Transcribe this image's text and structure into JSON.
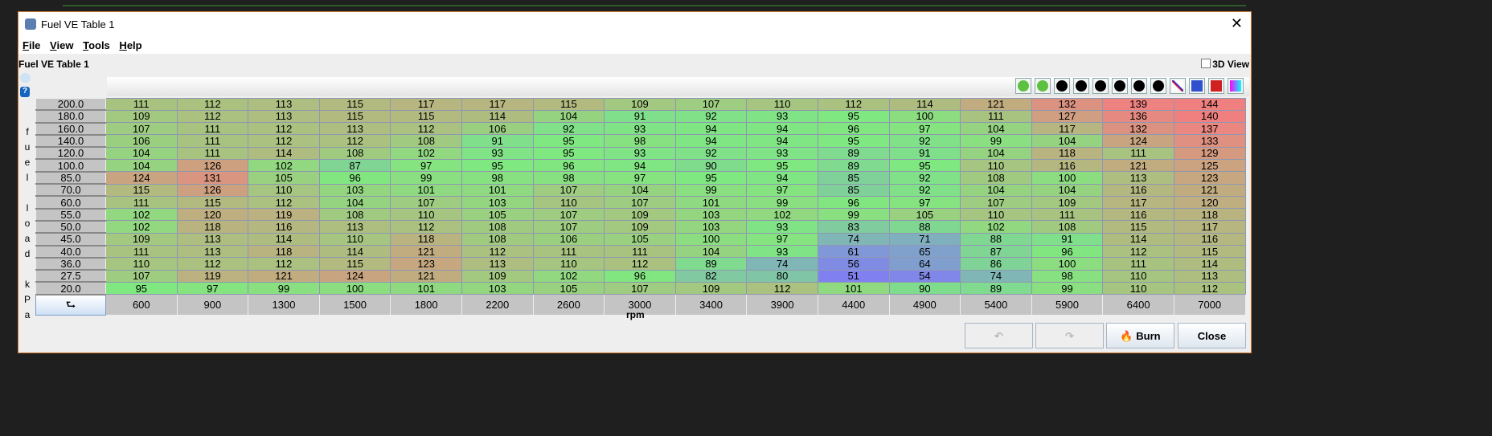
{
  "window": {
    "title": "Fuel VE Table 1",
    "close": "✕"
  },
  "menu": [
    "File",
    "View",
    "Tools",
    "Help"
  ],
  "panel_title": "Fuel VE Table 1",
  "view3d_label": "3D View",
  "y_axis_label": "fuel load kPa",
  "x_axis_label": "rpm",
  "help_icon": "?",
  "corner_icon": "⮑",
  "toolbar_icons": [
    "increment-icon",
    "decrement-icon",
    "set-equal-icon",
    "shift-up-icon",
    "shift-down-icon",
    "minus-icon",
    "plus-icon",
    "multiply-icon",
    "interpolate-icon",
    "horizontal-smooth-icon",
    "vertical-smooth-icon",
    "color-gradient-icon"
  ],
  "colors": {
    "low": "#8080f0",
    "mid": "#80e880",
    "high": "#f08080"
  },
  "load_bins": [
    "200.0",
    "180.0",
    "160.0",
    "140.0",
    "120.0",
    "100.0",
    "85.0",
    "70.0",
    "60.0",
    "55.0",
    "50.0",
    "45.0",
    "40.0",
    "36.0",
    "27.5",
    "20.0"
  ],
  "rpm_bins": [
    "600",
    "900",
    "1300",
    "1500",
    "1800",
    "2200",
    "2600",
    "3000",
    "3400",
    "3900",
    "4400",
    "4900",
    "5400",
    "5900",
    "6400",
    "7000"
  ],
  "ve": [
    [
      111,
      112,
      113,
      115,
      117,
      117,
      115,
      109,
      107,
      110,
      112,
      114,
      121,
      132,
      139,
      144
    ],
    [
      109,
      112,
      113,
      115,
      115,
      114,
      104,
      91,
      92,
      93,
      95,
      100,
      111,
      127,
      136,
      140
    ],
    [
      107,
      111,
      112,
      113,
      112,
      106,
      92,
      93,
      94,
      94,
      96,
      97,
      104,
      117,
      132,
      137
    ],
    [
      106,
      111,
      112,
      112,
      108,
      91,
      95,
      98,
      94,
      94,
      95,
      92,
      99,
      104,
      124,
      133
    ],
    [
      104,
      111,
      114,
      108,
      102,
      93,
      95,
      93,
      92,
      93,
      89,
      91,
      104,
      118,
      111,
      129
    ],
    [
      104,
      126,
      102,
      87,
      97,
      95,
      96,
      94,
      90,
      95,
      89,
      95,
      110,
      116,
      121,
      125
    ],
    [
      124,
      131,
      105,
      96,
      99,
      98,
      98,
      97,
      95,
      94,
      85,
      92,
      108,
      100,
      113,
      123
    ],
    [
      115,
      126,
      110,
      103,
      101,
      101,
      107,
      104,
      99,
      97,
      85,
      92,
      104,
      104,
      116,
      121
    ],
    [
      111,
      115,
      112,
      104,
      107,
      103,
      110,
      107,
      101,
      99,
      96,
      97,
      107,
      109,
      117,
      120
    ],
    [
      102,
      120,
      119,
      108,
      110,
      105,
      107,
      109,
      103,
      102,
      99,
      105,
      110,
      111,
      116,
      118
    ],
    [
      102,
      118,
      116,
      113,
      112,
      108,
      107,
      109,
      103,
      93,
      83,
      88,
      102,
      108,
      115,
      117
    ],
    [
      109,
      113,
      114,
      110,
      118,
      108,
      106,
      105,
      100,
      97,
      74,
      71,
      88,
      91,
      114,
      116
    ],
    [
      111,
      113,
      118,
      114,
      121,
      112,
      111,
      111,
      104,
      93,
      61,
      65,
      87,
      96,
      112,
      115
    ],
    [
      110,
      112,
      112,
      115,
      123,
      113,
      110,
      112,
      89,
      74,
      56,
      64,
      86,
      100,
      111,
      114
    ],
    [
      107,
      119,
      121,
      124,
      121,
      109,
      102,
      96,
      82,
      80,
      51,
      54,
      74,
      98,
      110,
      113
    ],
    [
      95,
      97,
      99,
      100,
      101,
      103,
      105,
      107,
      109,
      112,
      101,
      90,
      89,
      99,
      110,
      112
    ]
  ],
  "buttons": {
    "undo": "↶",
    "redo": "↷",
    "burn": "Burn",
    "close": "Close"
  }
}
